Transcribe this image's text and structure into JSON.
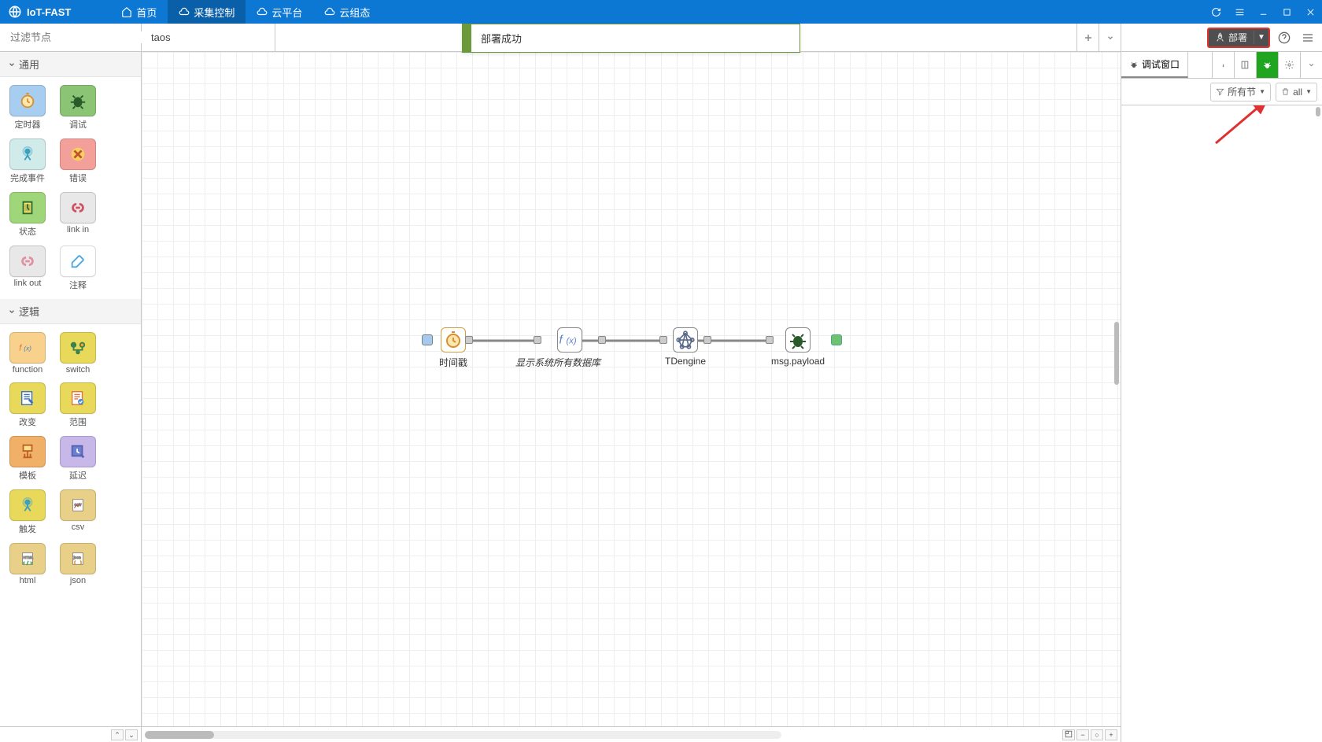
{
  "app": {
    "title": "IoT-FAST"
  },
  "menu": {
    "home": "首页",
    "collect": "采集控制",
    "cloud_platform": "云平台",
    "cloud_state": "云组态"
  },
  "palette": {
    "search_placeholder": "过滤节点",
    "categories": {
      "general": "通用",
      "logic": "逻辑"
    },
    "nodes": {
      "timer": "定时器",
      "debug": "调试",
      "complete": "完成事件",
      "catch": "错误",
      "status": "状态",
      "link_in": "link in",
      "link_out": "link out",
      "comment": "注释",
      "function": "function",
      "switch": "switch",
      "change": "改变",
      "range": "范围",
      "template": "模板",
      "delay": "延迟",
      "trigger": "触发",
      "csv": "csv",
      "html": "html",
      "json": "json"
    }
  },
  "tabs": {
    "tab1": "taos"
  },
  "notification": {
    "deploy_success": "部署成功"
  },
  "flow": {
    "n1": "时间戳",
    "n2": "显示系统所有数据库",
    "n3": "TDengine",
    "n4": "msg.payload"
  },
  "sidebar": {
    "deploy_label": "部署",
    "debug_tab": "调试窗口",
    "filter_label": "所有节",
    "all_label": "all"
  }
}
